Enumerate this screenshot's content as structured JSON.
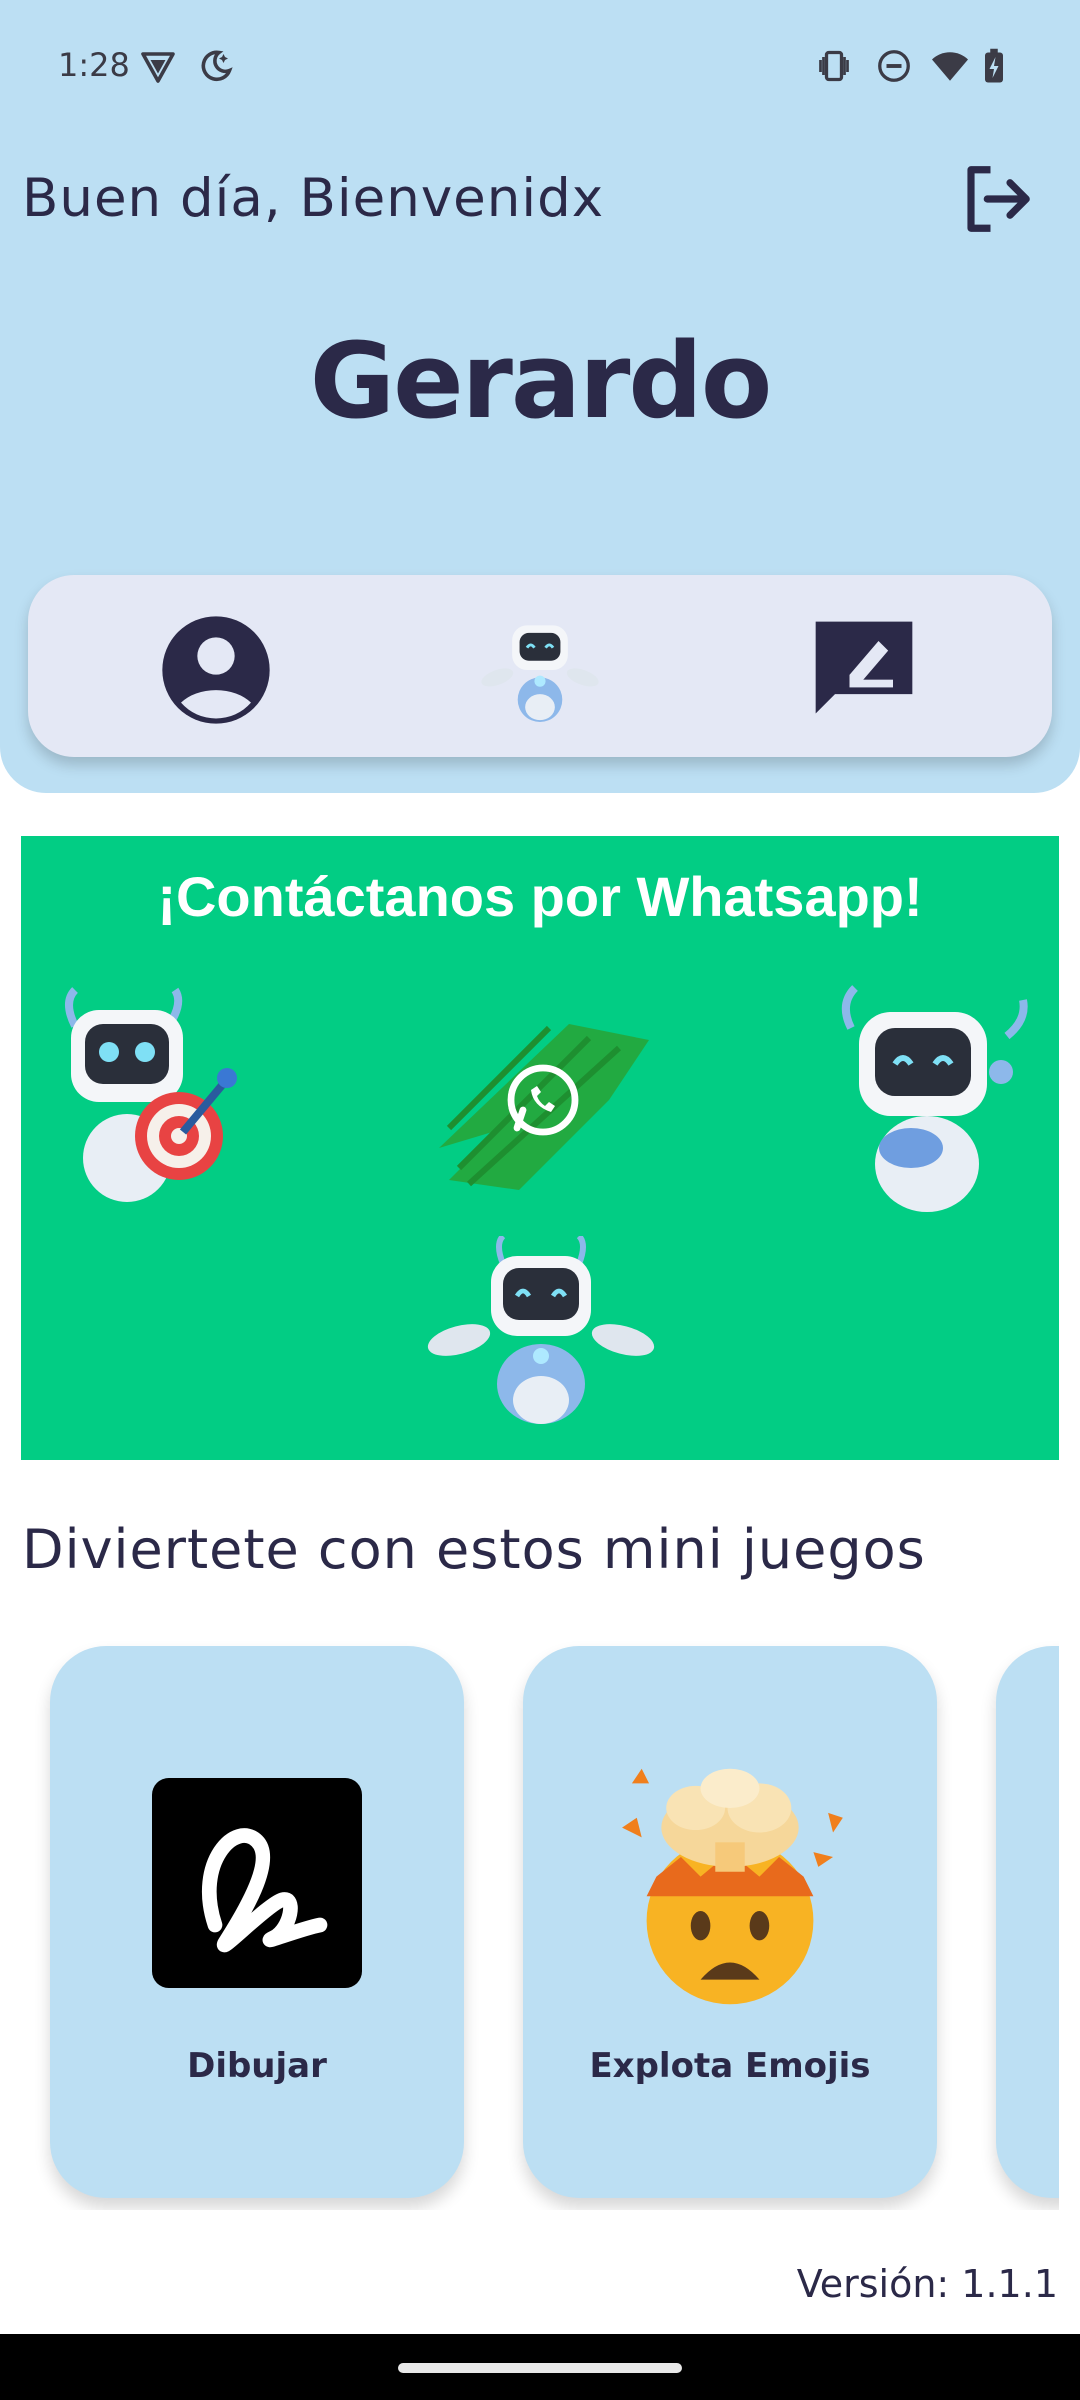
{
  "status_bar": {
    "time": "1:28",
    "icons": [
      "vpn-shield-icon",
      "night-moon-icon",
      "vibrate-icon",
      "do-not-disturb-icon",
      "wifi-icon",
      "battery-charging-icon"
    ]
  },
  "header": {
    "greeting": "Buen día, Bienvenidx",
    "user_name": "Gerardo",
    "logout_icon": "logout-icon",
    "background_color": "#bcdff3"
  },
  "nav_card": {
    "items": [
      {
        "icon": "profile-icon"
      },
      {
        "icon": "robot-mascot-icon"
      },
      {
        "icon": "feedback-edit-icon"
      }
    ]
  },
  "banner": {
    "title": "¡Contáctanos por Whatsapp!",
    "background_color": "#02cd84",
    "icon": "whatsapp-icon"
  },
  "games_section": {
    "title": "Diviertete con estos mini juegos",
    "games": [
      {
        "label": "Dibujar",
        "icon": "draw-squiggle-icon"
      },
      {
        "label": "Explota Emojis",
        "icon": "exploding-head-emoji-icon"
      }
    ]
  },
  "footer": {
    "version": "Versión: 1.1.1"
  }
}
